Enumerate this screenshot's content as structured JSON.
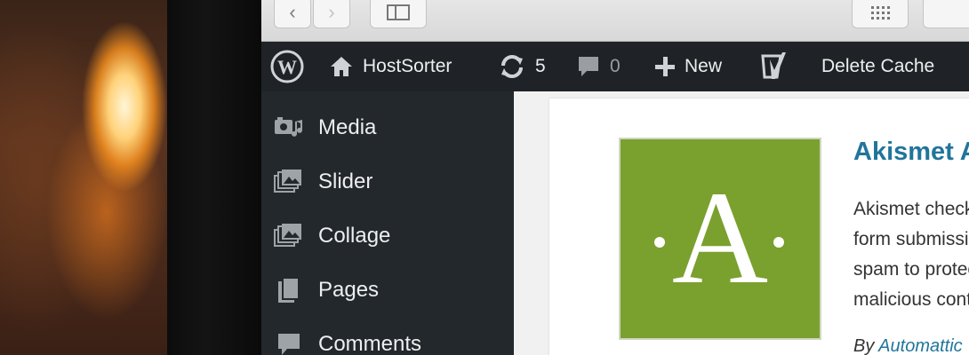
{
  "adminbar": {
    "site_name": "HostSorter",
    "updates_count": "5",
    "comments_count": "0",
    "new_label": "New",
    "cache_label": "Delete Cache"
  },
  "menu": {
    "items": [
      {
        "label": "Media",
        "icon": "media-icon"
      },
      {
        "label": "Slider",
        "icon": "slider-icon"
      },
      {
        "label": "Collage",
        "icon": "collage-icon"
      },
      {
        "label": "Pages",
        "icon": "pages-icon"
      },
      {
        "label": "Comments",
        "icon": "comments-icon"
      }
    ]
  },
  "plugin": {
    "logo_letter": "A",
    "title": "Akismet Anti-Spam",
    "description_lines": [
      "Akismet checks your comments and contact",
      "form submissions against our global database of",
      "spam to protect you and your site from",
      "malicious content."
    ],
    "author_prefix": "By",
    "author": "Automattic"
  },
  "colors": {
    "adminbar_bg": "#1f2327",
    "menu_bg": "#23282d",
    "logo_green": "#7aa02e",
    "link_blue": "#21759b"
  }
}
